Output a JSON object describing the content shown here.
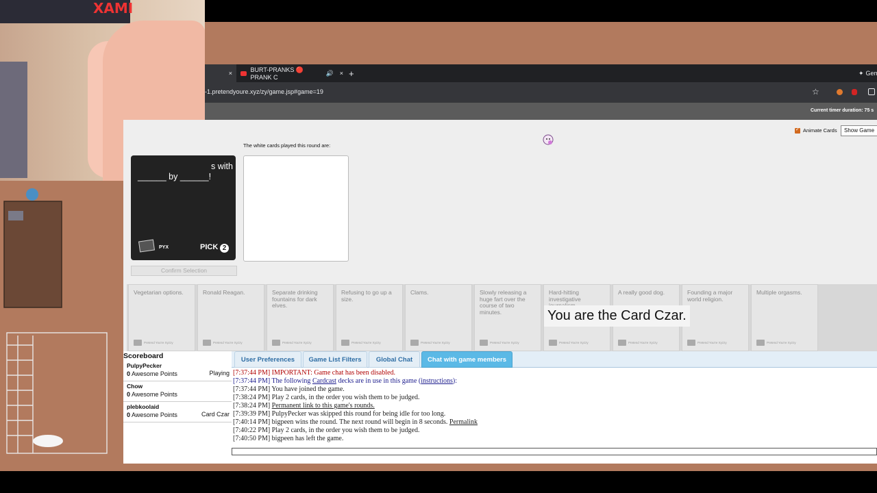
{
  "stream": {
    "poster_text": "XAMI"
  },
  "browser": {
    "tabs": [
      {
        "label": "",
        "close": "×"
      },
      {
        "label": "BURT-PRANKS 🔴 PRANK C",
        "close": "×"
      }
    ],
    "new_tab": "+",
    "gemini": "Gem",
    "url": "-1.pretendyoure.xyz/zy/game.jsp#game=19"
  },
  "header": {
    "timer": "Current timer duration: 75 s"
  },
  "game": {
    "animate_cards_label": "Animate Cards",
    "show_game_button": "Show Game",
    "white_cards_heading": "The white cards played this round are:",
    "black_card": {
      "text_line1": "s with",
      "text_line2": "______ by ______!",
      "brand": "PYX",
      "pick_label": "PICK",
      "pick_count": "2"
    },
    "confirm_button": "Confirm Selection",
    "card_czar_notice": "You are the Card Czar.",
    "hand": [
      {
        "text": "Vegetarian options.",
        "footer": "Pretend You're Xyzzy"
      },
      {
        "text": "Ronald Reagan.",
        "footer": "Pretend You're Xyzzy"
      },
      {
        "text": "Separate drinking fountains for dark elves.",
        "footer": "Pretend You're Xyzzy"
      },
      {
        "text": "Refusing to go up a size.",
        "footer": "Pretend You're Xyzzy"
      },
      {
        "text": "Clams.",
        "footer": "Pretend You're Xyzzy"
      },
      {
        "text": "Slowly releasing a huge fart over the course of two minutes.",
        "footer": "Pretend You're Xyzzy"
      },
      {
        "text": "Hard-hitting investigative journalism.",
        "footer": "Pretend You're Xyzzy"
      },
      {
        "text": "A really good dog.",
        "footer": "Pretend You're Xyzzy"
      },
      {
        "text": "Founding a major world religion.",
        "footer": "Pretend You're Xyzzy"
      },
      {
        "text": "Multiple orgasms.",
        "footer": "Pretend You're Xyzzy"
      }
    ]
  },
  "scoreboard": {
    "title": "Scoreboard",
    "players": [
      {
        "name": "PulpyPecker",
        "points": "0",
        "points_label": "Awesome Points",
        "status": "Playing"
      },
      {
        "name": "Chow",
        "points": "0",
        "points_label": "Awesome Points",
        "status": ""
      },
      {
        "name": "plebkoolaid",
        "points": "0",
        "points_label": "Awesome Points",
        "status": "Card Czar"
      }
    ]
  },
  "bottom_tabs": [
    "User Preferences",
    "Game List Filters",
    "Global Chat",
    "Chat with game members"
  ],
  "chat": [
    {
      "time": "[7:37:44 PM]",
      "text": "IMPORTANT: Game chat has been disabled.",
      "color": "#b00000"
    },
    {
      "time": "[7:37:44 PM]",
      "pre": "The following ",
      "link1": "Cardcast",
      "mid": " decks are in use in this game (",
      "link2": "instructions",
      "post": "):",
      "color": "#1a1a8c"
    },
    {
      "time": "[7:37:44 PM]",
      "text": "You have joined the game.",
      "color": "#222222"
    },
    {
      "time": "[7:38:24 PM]",
      "text": "Play 2 cards, in the order you wish them to be judged.",
      "color": "#222222"
    },
    {
      "time": "[7:38:24 PM]",
      "link": "Permanent link to this game's rounds.",
      "color": "#222222"
    },
    {
      "time": "[7:39:39 PM]",
      "text": "PulpyPecker was skipped this round for being idle for too long.",
      "color": "#222222"
    },
    {
      "time": "[7:40:14 PM]",
      "text": "bigpeen wins the round. The next round will begin in 8 seconds. ",
      "link": "Permalink",
      "color": "#222222"
    },
    {
      "time": "[7:40:22 PM]",
      "text": "Play 2 cards, in the order you wish them to be judged.",
      "color": "#222222"
    },
    {
      "time": "[7:40:50 PM]",
      "text": "bigpeen has left the game.",
      "color": "#222222"
    }
  ],
  "colors": {
    "accent_tab": "#5bb9e6",
    "tab_text": "#2e6da4",
    "important": "#b00000"
  }
}
